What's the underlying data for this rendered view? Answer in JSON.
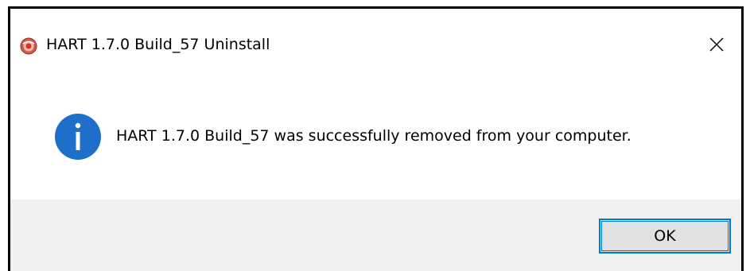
{
  "window": {
    "title": "HART 1.7.0 Build_57 Uninstall",
    "close_glyph": "✕",
    "app_icon": "installer-app-icon"
  },
  "message": {
    "icon": "info-icon",
    "text": "HART 1.7.0 Build_57 was successfully removed from your computer."
  },
  "buttons": {
    "ok_label": "OK"
  },
  "colors": {
    "info_blue": "#1e6fc9",
    "focus_border": "#0078d7",
    "footer_bg": "#f0f0f0"
  }
}
